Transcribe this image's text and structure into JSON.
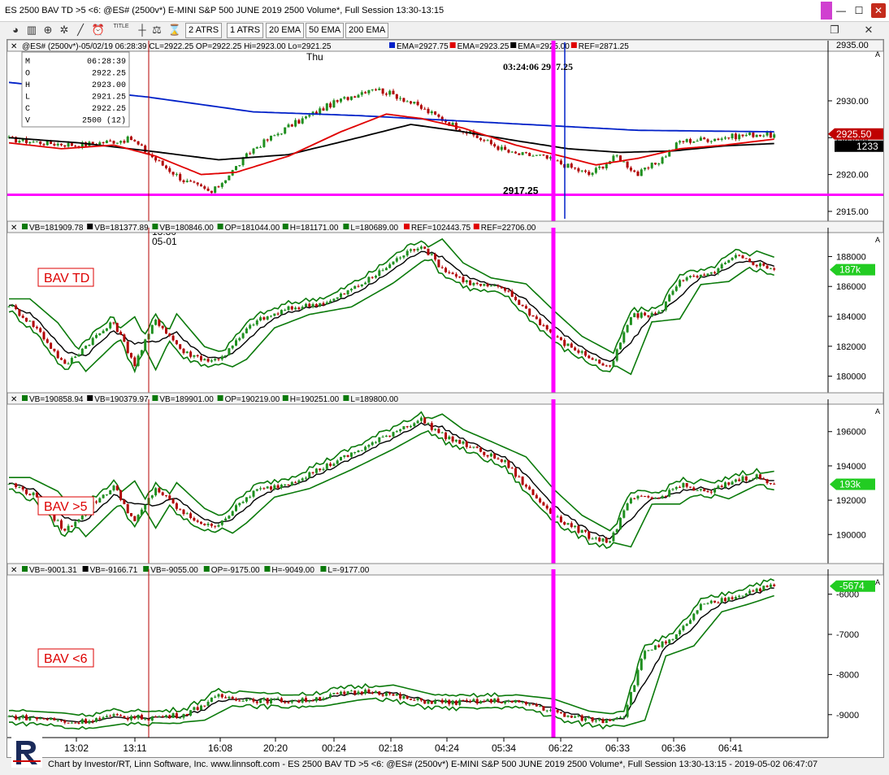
{
  "window": {
    "title": "ES 2500 BAV TD >5 <6: @ES# (2500v*) E-MINI S&P 500 JUNE 2019 2500 Volume*, Full Session 13:30-13:15",
    "minimize": "—",
    "maximize": "☐",
    "close": "✕",
    "restore": "❐",
    "close2": "✕"
  },
  "toolbar": {
    "buttons": [
      "2 ATRS",
      "1 ATRS",
      "20 EMA",
      "50 EMA",
      "200 EMA"
    ],
    "title_icon_label": "TITLE"
  },
  "colors": {
    "candle_up": "#1f8f1f",
    "candle_down": "#b00000",
    "ema20": "#e00000",
    "ema50": "#000000",
    "ema200": "#0020c8",
    "ref": "#ff00ff",
    "band": "#0b7a0b",
    "cursor_blue": "#0020c8"
  },
  "footer": "Chart by Investor/RT, Linn Software, Inc. www.linnsoft.com - ES 2500 BAV TD >5 <6: @ES# (2500v*) E-MINI S&P 500 JUNE 2019 2500 Volume*, Full Session 13:30-13:15 - 2019-05-02 06:47:07",
  "chart_data": [
    {
      "type": "candlestick",
      "legend": "@ES# (2500v*)-05/02/19 06:28:39 CL=2922.25 OP=2922.25 Hi=2923.00 Lo=2921.25",
      "indicators": [
        {
          "label": "EMA=2927.75",
          "color": "#0020c8"
        },
        {
          "label": "EMA=2923.25",
          "color": "#e00000"
        },
        {
          "label": "EMA=2925.00",
          "color": "#000000"
        },
        {
          "label": "REF=2871.25",
          "color": "#e00000"
        }
      ],
      "info_box": {
        "rows": [
          {
            "k": "M",
            "v": "06:28:39"
          },
          {
            "k": "O",
            "v": "2922.25"
          },
          {
            "k": "H",
            "v": "2923.00"
          },
          {
            "k": "L",
            "v": "2921.25"
          },
          {
            "k": "C",
            "v": "2922.25"
          },
          {
            "k": "V",
            "v": "2500 (12)"
          }
        ]
      },
      "annotations": {
        "day_label": "Thu",
        "cursor_text": "03:24:06 2917.25",
        "ref_line_label": "2917.25",
        "session_label": [
          "13:30",
          "05-01"
        ]
      },
      "ticks": [
        2930.0,
        2925.0,
        2920.0,
        2915.0
      ],
      "tick_labels": [
        "2930.00",
        "2925.00",
        "2920.00",
        "2915.00"
      ],
      "top_tick_label": "2935.00",
      "ylim": [
        2914,
        2937.5
      ],
      "ref_value": 2917.25,
      "price_tag": "2925.50",
      "bars_tag": "1233",
      "anchors": {
        "close": [
          [
            0,
            2924.8
          ],
          [
            10,
            2924.3
          ],
          [
            20,
            2924
          ],
          [
            35,
            2924.8
          ],
          [
            42,
            2922
          ],
          [
            50,
            2919.2
          ],
          [
            58,
            2917.5
          ],
          [
            62,
            2919.5
          ],
          [
            70,
            2923.5
          ],
          [
            80,
            2926.5
          ],
          [
            92,
            2929.5
          ],
          [
            104,
            2931.8
          ],
          [
            112,
            2930.5
          ],
          [
            122,
            2928
          ],
          [
            132,
            2925.5
          ],
          [
            144,
            2922.8
          ],
          [
            152,
            2922.5
          ],
          [
            158,
            2921.5
          ],
          [
            166,
            2920
          ],
          [
            174,
            2922.5
          ],
          [
            180,
            2920
          ],
          [
            186,
            2921.8
          ],
          [
            192,
            2924.5
          ],
          [
            200,
            2924.8
          ],
          [
            208,
            2925.2
          ],
          [
            214,
            2925.5
          ],
          [
            219,
            2925.3
          ]
        ],
        "ema200": [
          [
            0,
            2932.5
          ],
          [
            40,
            2930.5
          ],
          [
            70,
            2928.5
          ],
          [
            100,
            2928
          ],
          [
            140,
            2927
          ],
          [
            180,
            2926
          ],
          [
            219,
            2925.8
          ]
        ],
        "ema20": [
          [
            0,
            2924.3
          ],
          [
            15,
            2923.5
          ],
          [
            30,
            2924
          ],
          [
            42,
            2922.5
          ],
          [
            55,
            2920
          ],
          [
            65,
            2920.3
          ],
          [
            80,
            2922.5
          ],
          [
            95,
            2925.8
          ],
          [
            108,
            2928.2
          ],
          [
            118,
            2927.6
          ],
          [
            130,
            2926.3
          ],
          [
            145,
            2924
          ],
          [
            158,
            2922.5
          ],
          [
            168,
            2921.3
          ],
          [
            180,
            2922.2
          ],
          [
            192,
            2923.5
          ],
          [
            205,
            2924
          ],
          [
            219,
            2924.8
          ]
        ],
        "ema50": [
          [
            0,
            2925
          ],
          [
            20,
            2924.3
          ],
          [
            40,
            2923.2
          ],
          [
            60,
            2922
          ],
          [
            80,
            2922.7
          ],
          [
            100,
            2925
          ],
          [
            115,
            2926.8
          ],
          [
            130,
            2925.8
          ],
          [
            145,
            2924.6
          ],
          [
            160,
            2923.5
          ],
          [
            175,
            2923
          ],
          [
            190,
            2923.2
          ],
          [
            205,
            2923.9
          ],
          [
            219,
            2924.2
          ]
        ]
      }
    },
    {
      "type": "candlestick",
      "label": "BAV TD",
      "legend_items": [
        {
          "label": "VB=181909.78",
          "color": "#0b7a0b"
        },
        {
          "label": "VB=181377.89",
          "color": "#000000"
        },
        {
          "label": "VB=180846.00",
          "color": "#0b7a0b"
        },
        {
          "label": "OP=181044.00",
          "color": "#0b7a0b"
        },
        {
          "label": "H=181171.00",
          "color": "#0b7a0b"
        },
        {
          "label": "L=180689.00",
          "color": "#0b7a0b"
        },
        {
          "label": "REF=102443.75",
          "color": "#e00000"
        },
        {
          "label": "REF=22706.00",
          "color": "#e00000"
        }
      ],
      "ticks": [
        188000,
        186000,
        184000,
        182000,
        180000
      ],
      "tick_labels": [
        "188000",
        "186000",
        "184000",
        "182000",
        "180000"
      ],
      "ylim": [
        179000,
        189600
      ],
      "price_tag": "187k",
      "anchors": [
        [
          0,
          184800
        ],
        [
          8,
          183200
        ],
        [
          16,
          180700
        ],
        [
          24,
          182500
        ],
        [
          30,
          183600
        ],
        [
          36,
          180800
        ],
        [
          42,
          183800
        ],
        [
          50,
          181600
        ],
        [
          58,
          181000
        ],
        [
          62,
          181500
        ],
        [
          70,
          183600
        ],
        [
          80,
          184500
        ],
        [
          92,
          185000
        ],
        [
          104,
          186600
        ],
        [
          112,
          188000
        ],
        [
          118,
          188800
        ],
        [
          124,
          187200
        ],
        [
          132,
          186200
        ],
        [
          142,
          185800
        ],
        [
          150,
          184000
        ],
        [
          158,
          182300
        ],
        [
          166,
          181300
        ],
        [
          172,
          180500
        ],
        [
          178,
          184000
        ],
        [
          186,
          184200
        ],
        [
          192,
          186500
        ],
        [
          200,
          186700
        ],
        [
          208,
          188000
        ],
        [
          214,
          187500
        ],
        [
          219,
          187200
        ]
      ]
    },
    {
      "type": "candlestick",
      "label": "BAV >5",
      "legend_items": [
        {
          "label": "VB=190858.94",
          "color": "#0b7a0b"
        },
        {
          "label": "VB=190379.97",
          "color": "#000000"
        },
        {
          "label": "VB=189901.00",
          "color": "#0b7a0b"
        },
        {
          "label": "OP=190219.00",
          "color": "#0b7a0b"
        },
        {
          "label": "H=190251.00",
          "color": "#0b7a0b"
        },
        {
          "label": "L=189800.00",
          "color": "#0b7a0b"
        }
      ],
      "ticks": [
        196000,
        194000,
        192000,
        190000
      ],
      "tick_labels": [
        "196000",
        "194000",
        "192000",
        "190000"
      ],
      "ylim": [
        188400,
        197600
      ],
      "price_tag": "193k",
      "anchors": [
        [
          0,
          193000
        ],
        [
          8,
          192200
        ],
        [
          16,
          190200
        ],
        [
          24,
          191800
        ],
        [
          30,
          192800
        ],
        [
          36,
          190700
        ],
        [
          42,
          192700
        ],
        [
          50,
          191200
        ],
        [
          58,
          190400
        ],
        [
          62,
          191000
        ],
        [
          70,
          192500
        ],
        [
          80,
          193000
        ],
        [
          92,
          194100
        ],
        [
          104,
          195300
        ],
        [
          112,
          196200
        ],
        [
          118,
          196700
        ],
        [
          124,
          195800
        ],
        [
          132,
          195100
        ],
        [
          142,
          194200
        ],
        [
          150,
          192300
        ],
        [
          158,
          190800
        ],
        [
          166,
          189900
        ],
        [
          172,
          189600
        ],
        [
          178,
          192100
        ],
        [
          186,
          192100
        ],
        [
          192,
          192900
        ],
        [
          200,
          192400
        ],
        [
          208,
          193200
        ],
        [
          214,
          193400
        ],
        [
          219,
          192800
        ]
      ]
    },
    {
      "type": "candlestick",
      "label": "BAV <6",
      "legend_items": [
        {
          "label": "VB=-9001.31",
          "color": "#0b7a0b"
        },
        {
          "label": "VB=-9166.71",
          "color": "#000000"
        },
        {
          "label": "VB=-9055.00",
          "color": "#0b7a0b"
        },
        {
          "label": "OP=-9175.00",
          "color": "#0b7a0b"
        },
        {
          "label": "H=-9049.00",
          "color": "#0b7a0b"
        },
        {
          "label": "L=-9177.00",
          "color": "#0b7a0b"
        }
      ],
      "ticks": [
        -6000,
        -7000,
        -8000,
        -9000
      ],
      "tick_labels": [
        "-6000",
        "-7000",
        "-8000",
        "-9000"
      ],
      "ylim": [
        -9450,
        -5500
      ],
      "price_tag": "-5674",
      "anchors": [
        [
          0,
          -9050
        ],
        [
          10,
          -9100
        ],
        [
          18,
          -9200
        ],
        [
          30,
          -9050
        ],
        [
          40,
          -9080
        ],
        [
          50,
          -9000
        ],
        [
          60,
          -8550
        ],
        [
          72,
          -8650
        ],
        [
          84,
          -8650
        ],
        [
          94,
          -8500
        ],
        [
          104,
          -8400
        ],
        [
          116,
          -8650
        ],
        [
          128,
          -8700
        ],
        [
          140,
          -8650
        ],
        [
          150,
          -8750
        ],
        [
          160,
          -9050
        ],
        [
          170,
          -9150
        ],
        [
          176,
          -9000
        ],
        [
          182,
          -7400
        ],
        [
          190,
          -7150
        ],
        [
          198,
          -6300
        ],
        [
          206,
          -6100
        ],
        [
          214,
          -5870
        ],
        [
          219,
          -5800
        ]
      ]
    }
  ],
  "x_axis": {
    "labels": [
      "13:02",
      "13:11",
      "16:08",
      "20:20",
      "00:24",
      "02:18",
      "04:24",
      "05:34",
      "06:22",
      "06:33",
      "06:36",
      "06:41"
    ],
    "vline_label_index": 1,
    "ref_cursor_index": 8
  }
}
